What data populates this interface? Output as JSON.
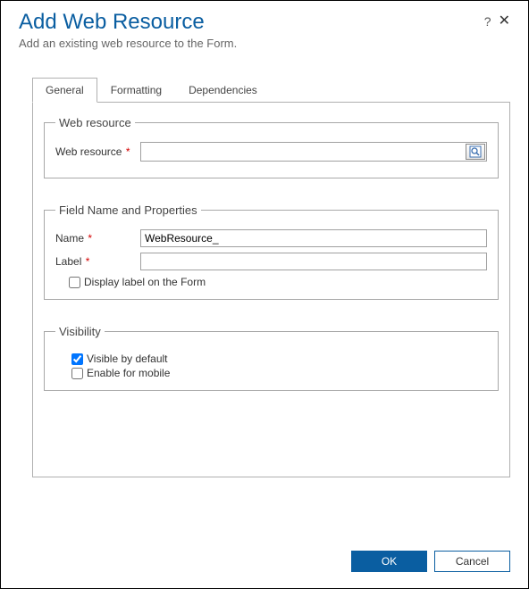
{
  "header": {
    "title": "Add Web Resource",
    "subtitle": "Add an existing web resource to the Form."
  },
  "tabs": [
    {
      "label": "General",
      "active": true
    },
    {
      "label": "Formatting",
      "active": false
    },
    {
      "label": "Dependencies",
      "active": false
    }
  ],
  "section_webresource": {
    "legend": "Web resource",
    "field_label": "Web resource",
    "value": ""
  },
  "section_fieldname": {
    "legend": "Field Name and Properties",
    "name_label": "Name",
    "name_value": "WebResource_",
    "label_label": "Label",
    "label_value": "",
    "display_label_checkbox": "Display label on the Form"
  },
  "section_visibility": {
    "legend": "Visibility",
    "visible_default": "Visible by default",
    "enable_mobile": "Enable for mobile"
  },
  "footer": {
    "ok": "OK",
    "cancel": "Cancel"
  }
}
